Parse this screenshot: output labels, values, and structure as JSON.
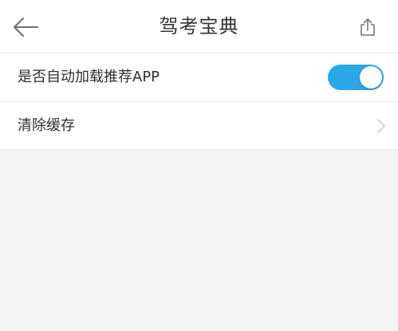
{
  "header": {
    "title": "驾考宝典",
    "back_icon": "arrow-left-icon",
    "share_icon": "share-icon"
  },
  "settings": {
    "items": [
      {
        "label": "是否自动加载推荐APP",
        "control": "toggle",
        "on": true
      },
      {
        "label": "清除缓存",
        "control": "chevron",
        "icon": "chevron-right-icon"
      }
    ]
  },
  "colors": {
    "accent": "#29a7e8",
    "background": "#f4f4f6",
    "surface": "#ffffff"
  }
}
